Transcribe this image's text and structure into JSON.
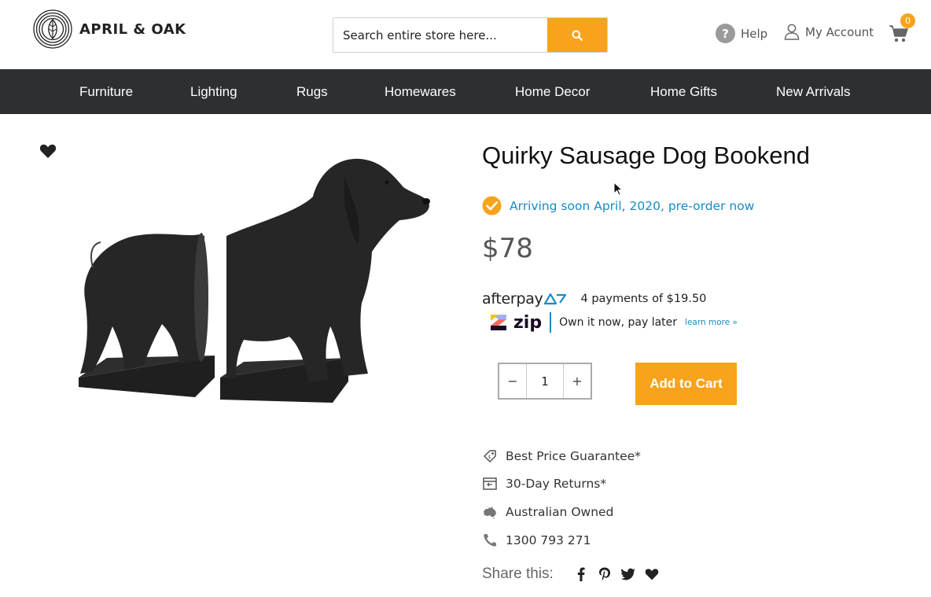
{
  "brand": {
    "name": "APRIL & OAK"
  },
  "search": {
    "placeholder": "Search entire store here..."
  },
  "header": {
    "help_label": "Help",
    "account_label": "My Account",
    "cart_count": "0",
    "help_glyph": "?"
  },
  "nav": {
    "items": [
      "Furniture",
      "Lighting",
      "Rugs",
      "Homewares",
      "Home Decor",
      "Home Gifts",
      "New Arrivals"
    ]
  },
  "product": {
    "title": "Quirky Sausage Dog Bookend",
    "status": "Arriving soon April, 2020, pre-order now",
    "price": "$78",
    "afterpay_logo": "afterpay",
    "afterpay_text": "4 payments of $19.50",
    "zip_logo": "zip",
    "zip_text": "Own it now, pay later",
    "zip_link": "learn more »",
    "quantity": "1",
    "qty_minus": "−",
    "qty_plus": "+",
    "add_to_cart": "Add to Cart"
  },
  "features": [
    {
      "label": "Best Price Guarantee*",
      "icon": "price-tag-icon"
    },
    {
      "label": "30-Day Returns*",
      "icon": "returns-box-icon"
    },
    {
      "label": "Australian Owned",
      "icon": "australia-map-icon"
    },
    {
      "label": "1300 793 271",
      "icon": "phone-icon"
    }
  ],
  "share": {
    "label": "Share this:"
  },
  "colors": {
    "accent": "#f7a31c",
    "nav_bg": "#2d2f31",
    "link": "#1a8ac4"
  }
}
